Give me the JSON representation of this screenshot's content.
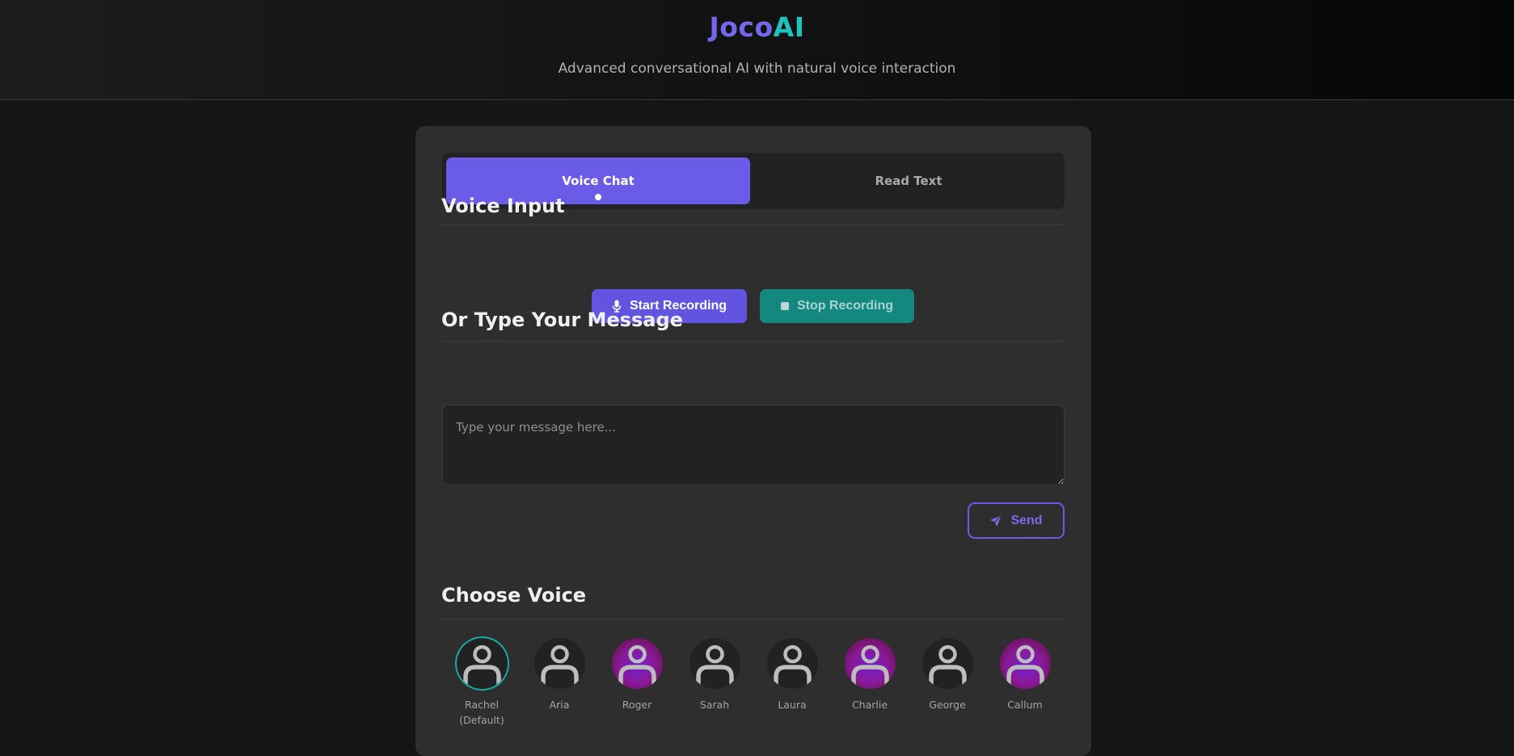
{
  "header": {
    "logo_part1": "Joco",
    "logo_part2": "AI",
    "tagline": "Advanced conversational AI with natural voice interaction"
  },
  "tabs": [
    {
      "label": "Voice Chat",
      "active": true
    },
    {
      "label": "Read Text",
      "active": false
    }
  ],
  "voice_input": {
    "title": "Voice Input",
    "start_label": "Start Recording",
    "stop_label": "Stop Recording"
  },
  "message": {
    "title": "Or Type Your Message",
    "placeholder": "Type your message here...",
    "send_label": "Send"
  },
  "voices": {
    "title": "Choose Voice",
    "items": [
      {
        "name": "Rachel",
        "note": "(Default)",
        "selected": true,
        "tinted": false
      },
      {
        "name": "Aria",
        "note": "",
        "selected": false,
        "tinted": false
      },
      {
        "name": "Roger",
        "note": "",
        "selected": false,
        "tinted": true
      },
      {
        "name": "Sarah",
        "note": "",
        "selected": false,
        "tinted": false
      },
      {
        "name": "Laura",
        "note": "",
        "selected": false,
        "tinted": false
      },
      {
        "name": "Charlie",
        "note": "",
        "selected": false,
        "tinted": true
      },
      {
        "name": "George",
        "note": "",
        "selected": false,
        "tinted": false
      },
      {
        "name": "Callum",
        "note": "",
        "selected": false,
        "tinted": true
      }
    ]
  },
  "colors": {
    "accent": "#6b5ce7",
    "teal": "#1fc3bc",
    "card": "#2e2e2e",
    "background": "#151515"
  },
  "icons": {
    "start": "microphone-icon",
    "stop": "stop-square-icon",
    "send": "paper-plane-icon",
    "avatar": "user-avatar-icon"
  }
}
